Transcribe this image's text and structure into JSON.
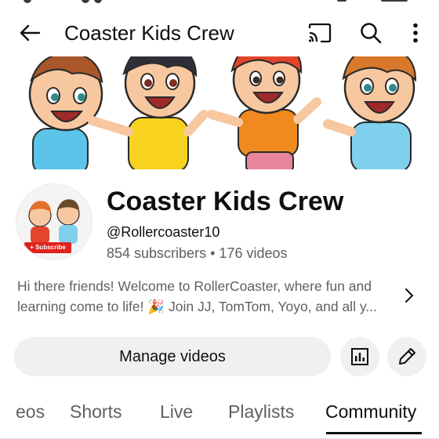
{
  "topbar": {
    "title": "Coaster Kids Crew",
    "icons": [
      "back-arrow-icon",
      "cast-icon",
      "search-icon",
      "more-vert-icon"
    ]
  },
  "channel": {
    "name": "Coaster Kids Crew",
    "handle": "@Rollercoaster10",
    "subscribers": "854 subscribers",
    "separator": "•",
    "videos": "176 videos",
    "avatar_chip": "+ Subscribe",
    "description_line1": "Hi there friends! Welcome to RollerCoaster, where fun and",
    "description_line2": "learning come to life! 🎉 Join JJ, TomTom, Yoyo, and all y..."
  },
  "actions": {
    "manage_label": "Manage videos",
    "icons": [
      "analytics-icon",
      "edit-pencil-icon"
    ]
  },
  "tabs": [
    {
      "label": "eos"
    },
    {
      "label": "Shorts"
    },
    {
      "label": "Live"
    },
    {
      "label": "Playlists"
    },
    {
      "label": "Community",
      "active": true
    }
  ],
  "colors": {
    "text_primary": "#0f0f0f",
    "text_secondary": "#606060",
    "button_bg": "#f0f0f0",
    "subscribe_red": "#e0231d"
  }
}
